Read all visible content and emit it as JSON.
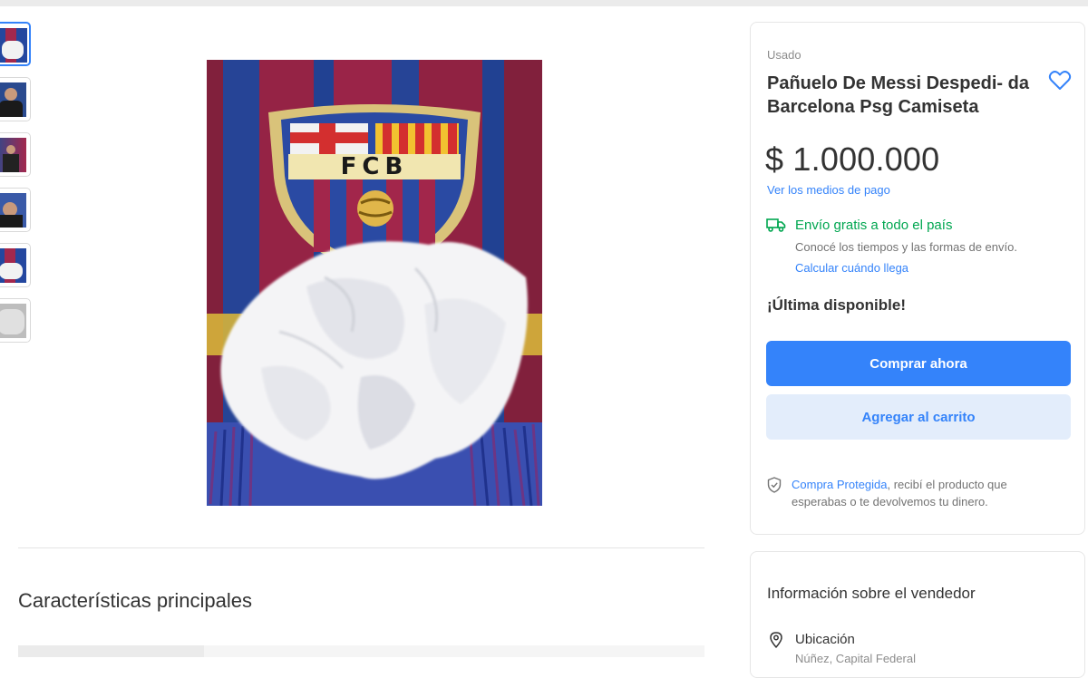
{
  "product": {
    "condition": "Usado",
    "title": "Pañuelo De Messi Despedi- da Barcelona Psg Camiseta",
    "price": "$ 1.000.000",
    "payment_link": "Ver los medios de pago",
    "crest_text": "FCB"
  },
  "shipping": {
    "title": "Envío gratis a todo el país",
    "subtitle": "Conocé los tiempos y las formas de envío.",
    "calc_link": "Calcular cuándo llega"
  },
  "stock_text": "¡Última disponible!",
  "actions": {
    "buy_now": "Comprar ahora",
    "add_to_cart": "Agregar al carrito"
  },
  "protection": {
    "link": "Compra Protegida",
    "text": ", recibí el producto que esperabas o te devolvemos tu dinero."
  },
  "main": {
    "section_title": "Características principales"
  },
  "seller": {
    "title": "Información sobre el vendedor",
    "location_label": "Ubicación",
    "location_value": "Núñez, Capital Federal"
  },
  "thumbnails": [
    {
      "name": "scarf-tissue",
      "selected": true
    },
    {
      "name": "messi-press-1",
      "selected": false
    },
    {
      "name": "messi-press-2",
      "selected": false
    },
    {
      "name": "messi-press-3",
      "selected": false
    },
    {
      "name": "scarf-tissue-2",
      "selected": false
    },
    {
      "name": "tissue-closeup",
      "selected": false
    }
  ],
  "colors": {
    "accent": "#3483fa",
    "success": "#00a650",
    "cart_button_bg": "#e3edfb",
    "barca_blue": "#1f3f9a",
    "barca_red": "#a2264b",
    "crest_gold": "#d9c37a"
  },
  "icons": {
    "favorite": "heart-icon",
    "shipping": "truck-icon",
    "protection": "shield-check-icon",
    "location": "location-pin-icon"
  }
}
